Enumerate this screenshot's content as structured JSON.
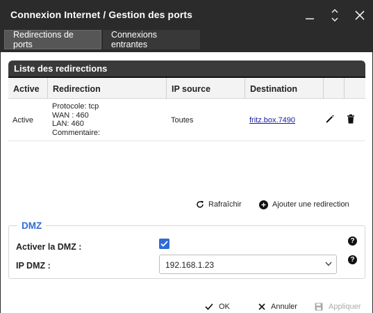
{
  "window": {
    "title": "Connexion Internet / Gestion des ports"
  },
  "tabs": [
    {
      "label": "Redirections de ports",
      "active": true
    },
    {
      "label": "Connexions entrantes",
      "active": false
    }
  ],
  "redirections": {
    "header": "Liste des redirections",
    "columns": [
      "Active",
      "Redirection",
      "IP source",
      "Destination"
    ],
    "rows": [
      {
        "active": "Active",
        "protocol": "Protocole: tcp",
        "wan": "WAN : 460",
        "lan": "LAN: 460",
        "comment": "Commentaire:",
        "ip_source": "Toutes",
        "destination": "fritz.box.7490"
      }
    ],
    "refresh_label": "Rafraîchir",
    "add_label": "Ajouter une redirection"
  },
  "dmz": {
    "legend": "DMZ",
    "enable_label": "Activer la DMZ :",
    "enabled": true,
    "ip_label": "IP DMZ :",
    "ip_value": "192.168.1.23"
  },
  "footer": {
    "ok": "OK",
    "cancel": "Annuler",
    "apply": "Appliquer"
  },
  "colors": {
    "accent": "#2f6bd6",
    "titlebar": "#2b2b2b"
  }
}
